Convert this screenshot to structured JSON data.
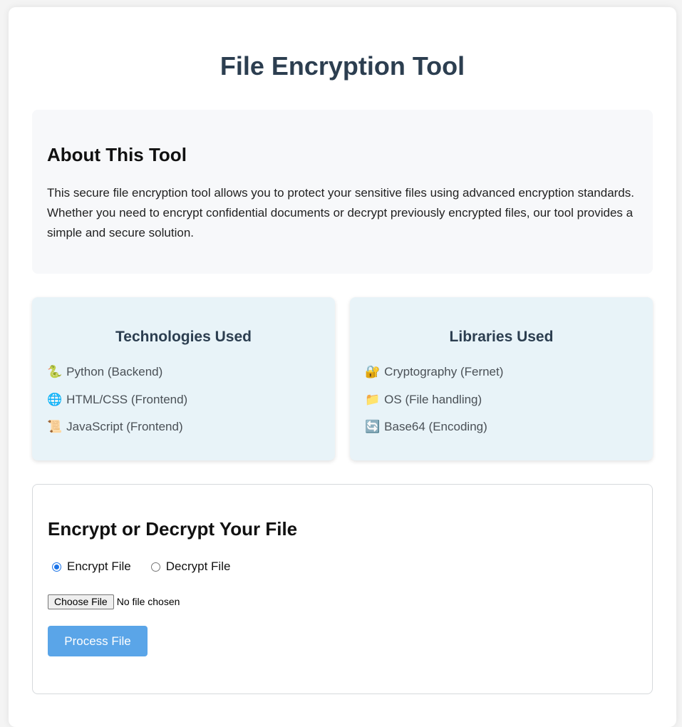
{
  "page": {
    "title": "File Encryption Tool"
  },
  "about": {
    "heading": "About This Tool",
    "text": "This secure file encryption tool allows you to protect your sensitive files using advanced encryption standards. Whether you need to encrypt confidential documents or decrypt previously encrypted files, our tool provides a simple and secure solution."
  },
  "technologies": {
    "heading": "Technologies Used",
    "items": [
      {
        "icon": "🐍",
        "icon_name": "snake-icon",
        "label": "Python (Backend)"
      },
      {
        "icon": "🌐",
        "icon_name": "globe-icon",
        "label": "HTML/CSS (Frontend)"
      },
      {
        "icon": "📜",
        "icon_name": "scroll-icon",
        "label": "JavaScript (Frontend)"
      }
    ]
  },
  "libraries": {
    "heading": "Libraries Used",
    "items": [
      {
        "icon": "🔐",
        "icon_name": "lock-key-icon",
        "label": "Cryptography (Fernet)"
      },
      {
        "icon": "📁",
        "icon_name": "folder-icon",
        "label": "OS (File handling)"
      },
      {
        "icon": "🔄",
        "icon_name": "arrows-cycle-icon",
        "label": "Base64 (Encoding)"
      }
    ]
  },
  "form": {
    "heading": "Encrypt or Decrypt Your File",
    "mode_options": [
      {
        "label": "Encrypt File",
        "checked": true
      },
      {
        "label": "Decrypt File",
        "checked": false
      }
    ],
    "choose_file_label": "Choose File",
    "file_status": "No file chosen",
    "submit_label": "Process File"
  },
  "colors": {
    "title": "#2c3e50",
    "card_bg": "#e8f3f8",
    "about_bg": "#f7f8fa",
    "button_bg": "#5aa5e8",
    "radio_accent": "#1a73e8"
  }
}
